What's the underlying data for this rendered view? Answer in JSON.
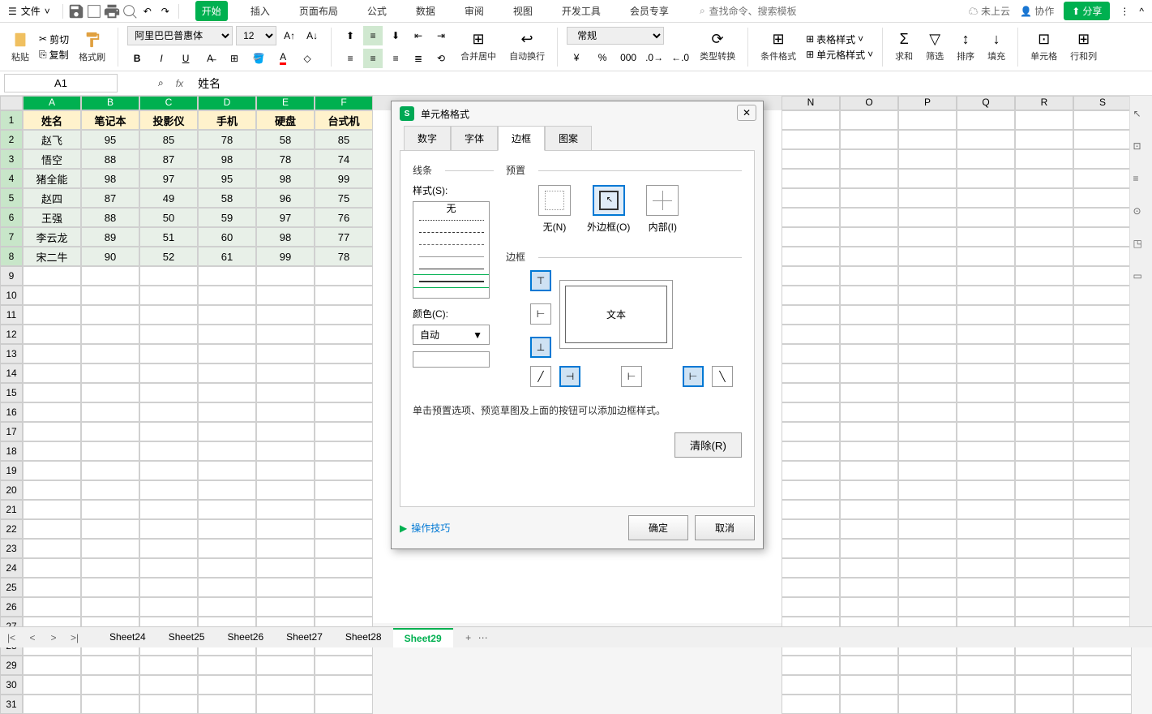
{
  "menubar": {
    "file_label": "文件",
    "search_placeholder": "查找命令、搜索模板",
    "cloud_label": "未上云",
    "collab_label": "协作",
    "share_label": "分享"
  },
  "tabs": {
    "start": "开始",
    "insert": "插入",
    "layout": "页面布局",
    "formula": "公式",
    "data": "数据",
    "review": "审阅",
    "view": "视图",
    "dev": "开发工具",
    "member": "会员专享"
  },
  "ribbon": {
    "paste": "粘贴",
    "cut": "剪切",
    "copy": "复制",
    "format_painter": "格式刷",
    "font_name": "阿里巴巴普惠体",
    "font_size": "12",
    "merge": "合并居中",
    "wrap": "自动换行",
    "num_format": "常规",
    "type_convert": "类型转换",
    "cond_format": "条件格式",
    "table_style": "表格样式",
    "cell_style": "单元格样式",
    "sum": "求和",
    "filter": "筛选",
    "sort": "排序",
    "fill": "填充",
    "cell": "单元格",
    "rowcol": "行和列"
  },
  "formula_bar": {
    "cell_ref": "A1",
    "fx": "fx",
    "content": "姓名"
  },
  "columns": [
    "A",
    "B",
    "C",
    "D",
    "E",
    "F",
    "N",
    "O",
    "P",
    "Q",
    "R",
    "S"
  ],
  "table": {
    "headers": [
      "姓名",
      "笔记本",
      "投影仪",
      "手机",
      "硬盘",
      "台式机"
    ],
    "rows": [
      [
        "赵飞",
        "95",
        "85",
        "78",
        "58",
        "85"
      ],
      [
        "悟空",
        "88",
        "87",
        "98",
        "78",
        "74"
      ],
      [
        "猪全能",
        "98",
        "97",
        "95",
        "98",
        "99"
      ],
      [
        "赵四",
        "87",
        "49",
        "58",
        "96",
        "75"
      ],
      [
        "王强",
        "88",
        "50",
        "59",
        "97",
        "76"
      ],
      [
        "李云龙",
        "89",
        "51",
        "60",
        "98",
        "77"
      ],
      [
        "宋二牛",
        "90",
        "52",
        "61",
        "99",
        "78"
      ]
    ]
  },
  "sheets": {
    "list": [
      "Sheet24",
      "Sheet25",
      "Sheet26",
      "Sheet27",
      "Sheet28",
      "Sheet29"
    ],
    "active": "Sheet29"
  },
  "dialog": {
    "title": "单元格格式",
    "tabs": {
      "number": "数字",
      "font": "字体",
      "border": "边框",
      "pattern": "图案"
    },
    "line_label": "线条",
    "style_label": "样式(S):",
    "style_none": "无",
    "color_label": "颜色(C):",
    "color_auto": "自动",
    "preset_label": "预置",
    "preset_none": "无(N)",
    "preset_outer": "外边框(O)",
    "preset_inner": "内部(I)",
    "border_label": "边框",
    "preview_text": "文本",
    "hint": "单击预置选项、预览草图及上面的按钮可以添加边框样式。",
    "clear": "清除(R)",
    "tips": "操作技巧",
    "ok": "确定",
    "cancel": "取消"
  }
}
